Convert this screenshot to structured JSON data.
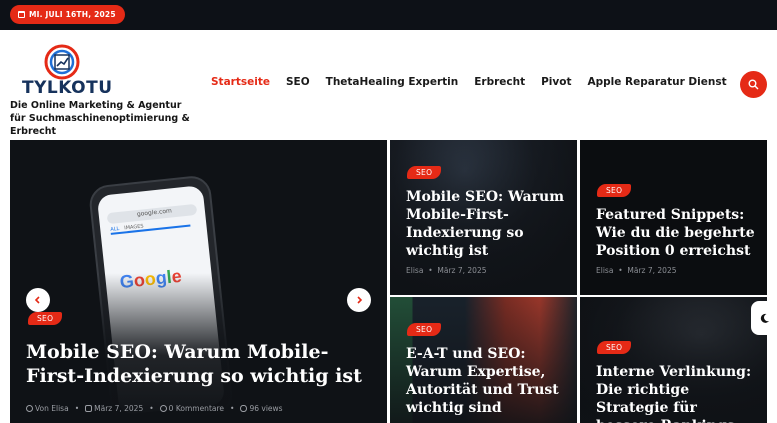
{
  "topbar": {
    "date": "MI. JULI 16TH, 2025",
    "icon": "calendar-icon"
  },
  "brand": {
    "logo_text": "TYLKOTU",
    "tagline": "Die Online Marketing & Agentur für Suchmaschinenoptimierung & Erbrecht",
    "colors": {
      "accent": "#e52a16",
      "navy": "#16325c",
      "dark": "#0d1117"
    }
  },
  "nav": {
    "items": [
      {
        "label": "Startseite",
        "active": true
      },
      {
        "label": "SEO"
      },
      {
        "label": "ThetaHealing Expertin"
      },
      {
        "label": "Erbrecht"
      },
      {
        "label": "Pivot"
      },
      {
        "label": "Apple Reparatur Dienst"
      }
    ],
    "search_icon": "search-icon"
  },
  "featured": {
    "category": "SEO",
    "title": "Mobile SEO: Warum Mobile-First-Indexierung so wichtig ist",
    "author": "Von Elisa",
    "date": "März 7, 2025",
    "comments": "0 Kommentare",
    "views": "96 views",
    "phone_text": {
      "url": "google.com",
      "logo": "Google",
      "tab_all": "ALL",
      "tab_images": "IMAGES"
    }
  },
  "cards": [
    {
      "category": "SEO",
      "title": "Mobile SEO: Warum Mobile-First-Indexierung so wichtig ist",
      "author": "Elisa",
      "date": "März 7, 2025"
    },
    {
      "category": "SEO",
      "title": "Featured Snippets: Wie du die begehrte Position 0 erreichst",
      "author": "Elisa",
      "date": "März 7, 2025"
    },
    {
      "category": "SEO",
      "title": "E-A-T und SEO: Warum Expertise, Autorität und Trust wichtig sind",
      "author": "",
      "date": ""
    },
    {
      "category": "SEO",
      "title": "Interne Verlinkung: Die richtige Strategie für bessere Rankings",
      "author": "",
      "date": ""
    }
  ],
  "theme_toggle_icon": "moon-icon"
}
